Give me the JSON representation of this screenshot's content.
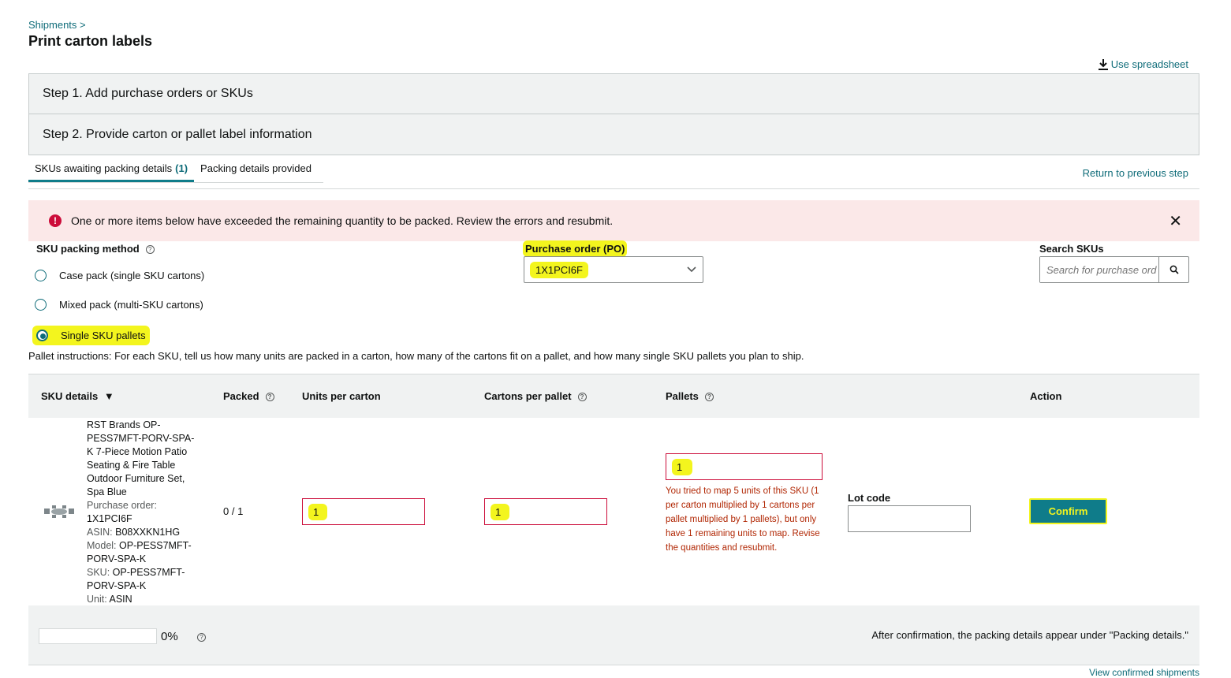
{
  "breadcrumb": "Shipments >",
  "page_title": "Print carton labels",
  "use_spreadsheet": "Use spreadsheet",
  "steps": [
    {
      "label": "Step 1. Add purchase orders or SKUs"
    },
    {
      "label": "Step 2. Provide carton or pallet label information"
    }
  ],
  "tabs": [
    {
      "label": "SKUs awaiting packing details",
      "count": "(1)"
    },
    {
      "label": "Packing details provided"
    }
  ],
  "return_link": "Return to previous step",
  "error_banner": {
    "message": "One or more items below have exceeded the remaining quantity to be packed. Review the errors and resubmit."
  },
  "packing_method": {
    "label": "SKU packing method",
    "options": [
      {
        "label": "Case pack (single SKU cartons)",
        "checked": false
      },
      {
        "label": "Mixed pack (multi-SKU cartons)",
        "checked": false
      },
      {
        "label": "Single SKU pallets",
        "checked": true
      }
    ]
  },
  "purchase_order": {
    "label": "Purchase order (PO)",
    "selected": "1X1PCI6F"
  },
  "search": {
    "label": "Search SKUs",
    "placeholder": "Search for purchase order"
  },
  "instructions": "Pallet instructions: For each SKU, tell us how many units are packed in a carton, how many of the cartons fit on a pallet, and how many single SKU pallets you plan to ship.",
  "table": {
    "headers": {
      "sku_details": "SKU details",
      "packed": "Packed",
      "units_per_carton": "Units per carton",
      "cartons_per_pallet": "Cartons per pallet",
      "pallets": "Pallets",
      "action": "Action"
    },
    "row": {
      "title": "RST Brands OP-PESS7MFT-PORV-SPA-K 7-Piece Motion Patio Seating & Fire Table Outdoor Furniture Set, Spa Blue",
      "po_label": "Purchase order:",
      "po_value": "1X1PCI6F",
      "asin_label": "ASIN:",
      "asin_value": "B08XXKN1HG",
      "model_label": "Model:",
      "model_value": "OP-PESS7MFT-PORV-SPA-K",
      "sku_label": "SKU:",
      "sku_value": "OP-PESS7MFT-PORV-SPA-K",
      "unit_label": "Unit:",
      "unit_value": "ASIN",
      "packed": "0 / 1",
      "units_per_carton": "1",
      "cartons_per_pallet": "1",
      "pallets": "1",
      "pallets_error": "You tried to map 5 units of this SKU (1 per carton multiplied by 1 cartons per pallet multiplied by 1 pallets), but only have 1 remaining units to map. Revise the quantities and resubmit.",
      "lot_code_label": "Lot code",
      "lot_code_value": "",
      "confirm_label": "Confirm"
    }
  },
  "footer": {
    "progress_percent": 0,
    "progress_text": "0%",
    "note": "After confirmation, the packing details appear under \"Packing details.\"",
    "view_confirmed": "View confirmed shipments"
  },
  "colors": {
    "accent": "#0f7c8a",
    "error": "#cc0c39",
    "highlight": "#f3f51e",
    "panel_bg": "#f0f2f2",
    "error_bg": "#fbe8e8"
  }
}
